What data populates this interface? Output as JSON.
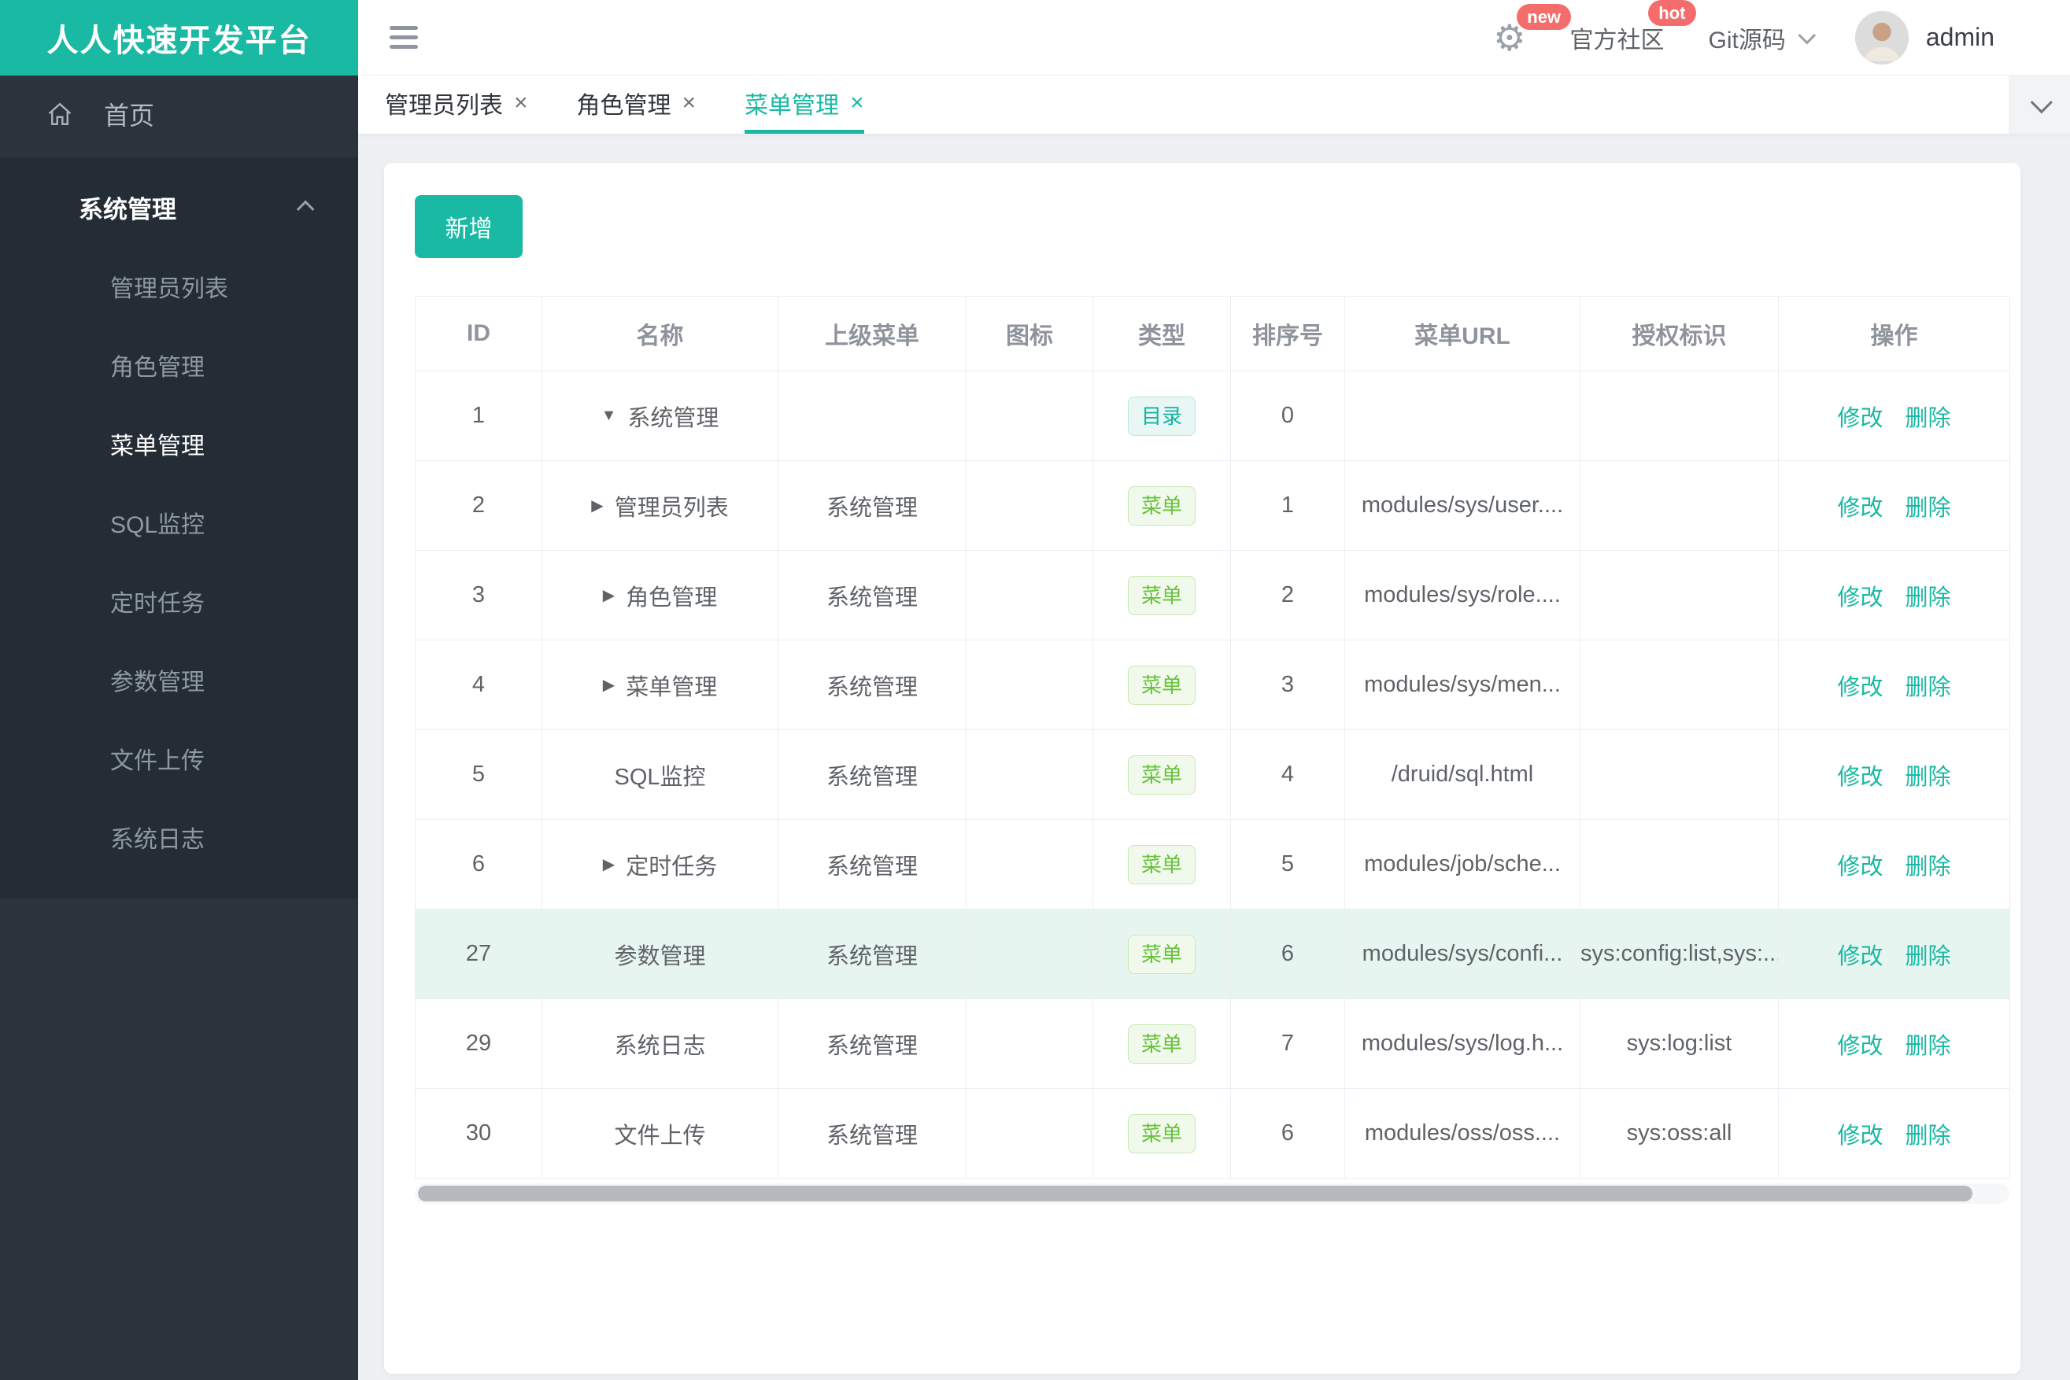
{
  "app": {
    "title": "人人快速开发平台"
  },
  "header": {
    "gear_badge": "new",
    "community_label": "官方社区",
    "community_badge": "hot",
    "git_label": "Git源码",
    "username": "admin"
  },
  "sidebar": {
    "home_label": "首页",
    "group_label": "系统管理",
    "items": [
      {
        "label": "管理员列表",
        "active": false
      },
      {
        "label": "角色管理",
        "active": false
      },
      {
        "label": "菜单管理",
        "active": true
      },
      {
        "label": "SQL监控",
        "active": false
      },
      {
        "label": "定时任务",
        "active": false
      },
      {
        "label": "参数管理",
        "active": false
      },
      {
        "label": "文件上传",
        "active": false
      },
      {
        "label": "系统日志",
        "active": false
      }
    ]
  },
  "tabs": [
    {
      "label": "管理员列表",
      "active": false
    },
    {
      "label": "角色管理",
      "active": false
    },
    {
      "label": "菜单管理",
      "active": true
    }
  ],
  "toolbar": {
    "add_label": "新增"
  },
  "table": {
    "columns": [
      "ID",
      "名称",
      "上级菜单",
      "图标",
      "类型",
      "排序号",
      "菜单URL",
      "授权标识",
      "操作"
    ],
    "type_labels": {
      "dir": "目录",
      "menu": "菜单"
    },
    "actions": {
      "edit": "修改",
      "delete": "删除"
    },
    "rows": [
      {
        "id": "1",
        "arrow": "down",
        "name": "系统管理",
        "parent": "",
        "icon": "",
        "type": "dir",
        "order": "0",
        "url": "",
        "perms": "",
        "highlight": false
      },
      {
        "id": "2",
        "arrow": "right",
        "name": "管理员列表",
        "parent": "系统管理",
        "icon": "",
        "type": "menu",
        "order": "1",
        "url": "modules/sys/user....",
        "perms": "",
        "highlight": false
      },
      {
        "id": "3",
        "arrow": "right",
        "name": "角色管理",
        "parent": "系统管理",
        "icon": "",
        "type": "menu",
        "order": "2",
        "url": "modules/sys/role....",
        "perms": "",
        "highlight": false
      },
      {
        "id": "4",
        "arrow": "right",
        "name": "菜单管理",
        "parent": "系统管理",
        "icon": "",
        "type": "menu",
        "order": "3",
        "url": "modules/sys/men...",
        "perms": "",
        "highlight": false
      },
      {
        "id": "5",
        "arrow": "none",
        "name": "SQL监控",
        "parent": "系统管理",
        "icon": "",
        "type": "menu",
        "order": "4",
        "url": "/druid/sql.html",
        "perms": "",
        "highlight": false
      },
      {
        "id": "6",
        "arrow": "right",
        "name": "定时任务",
        "parent": "系统管理",
        "icon": "",
        "type": "menu",
        "order": "5",
        "url": "modules/job/sche...",
        "perms": "",
        "highlight": false
      },
      {
        "id": "27",
        "arrow": "none",
        "name": "参数管理",
        "parent": "系统管理",
        "icon": "",
        "type": "menu",
        "order": "6",
        "url": "modules/sys/confi...",
        "perms": "sys:config:list,sys:...",
        "highlight": true
      },
      {
        "id": "29",
        "arrow": "none",
        "name": "系统日志",
        "parent": "系统管理",
        "icon": "",
        "type": "menu",
        "order": "7",
        "url": "modules/sys/log.h...",
        "perms": "sys:log:list",
        "highlight": false
      },
      {
        "id": "30",
        "arrow": "none",
        "name": "文件上传",
        "parent": "系统管理",
        "icon": "",
        "type": "menu",
        "order": "6",
        "url": "modules/oss/oss....",
        "perms": "sys:oss:all",
        "highlight": false
      }
    ]
  },
  "colors": {
    "accent_teal": "#1ab9a3",
    "badge_red": "#f56c6c",
    "sidebar_bg": "#2b343d",
    "sidebar_submenu_bg": "#242d36",
    "row_highlight": "#e7f5f0",
    "tag_dir_text": "#14b2a5",
    "tag_menu_text": "#67c23a",
    "table_border": "#ebeef5"
  }
}
